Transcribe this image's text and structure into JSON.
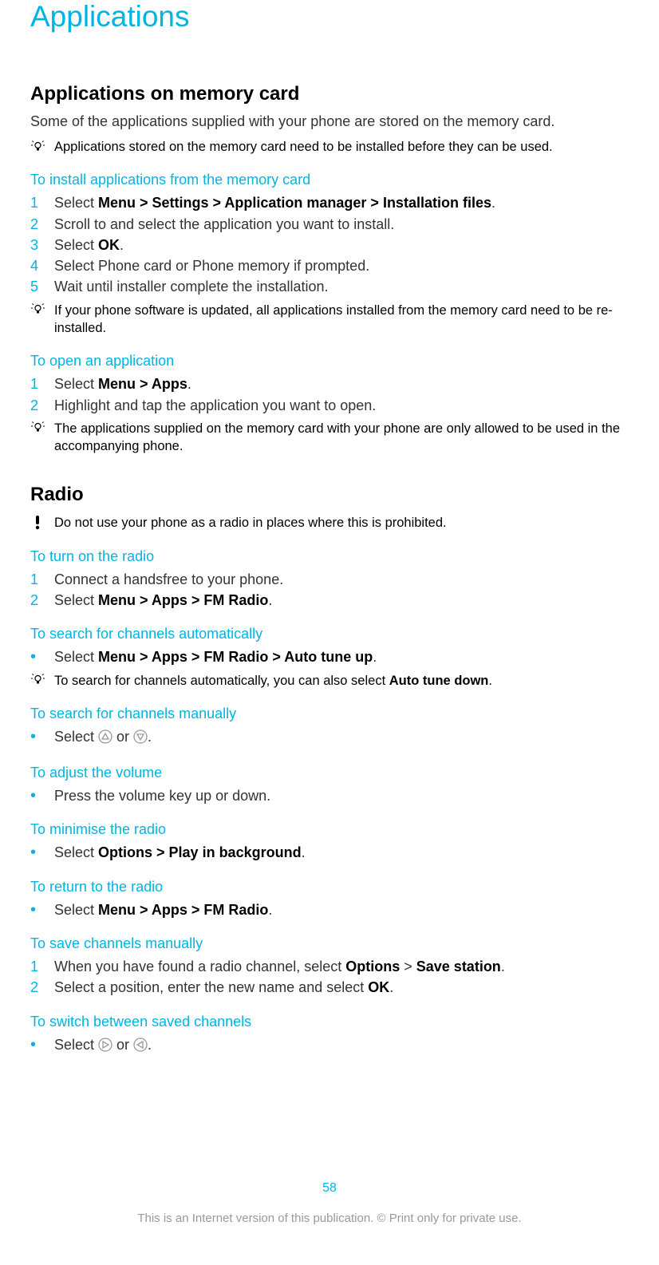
{
  "chapterTitle": "Applications",
  "section1": {
    "title": "Applications on memory card",
    "intro": "Some of the applications supplied with your phone are stored on the memory card.",
    "tip1": "Applications stored on the memory card need to be installed before they can be used.",
    "sub1": {
      "title": "To install applications from the memory card",
      "steps": [
        {
          "n": "1",
          "prefix": "Select ",
          "path": "Menu > Settings > Application manager > Installation files",
          "suffix": "."
        },
        {
          "n": "2",
          "plain": "Scroll to and select the application you want to install."
        },
        {
          "n": "3",
          "prefix": "Select ",
          "bold": "OK",
          "suffix": "."
        },
        {
          "n": "4",
          "plain": "Select Phone card or Phone memory if prompted."
        },
        {
          "n": "5",
          "plain": "Wait until installer complete the installation."
        }
      ],
      "tip": "If your phone software is updated, all applications installed from the memory card need to be re-installed."
    },
    "sub2": {
      "title": "To open an application",
      "steps": [
        {
          "n": "1",
          "prefix": "Select ",
          "path": "Menu > Apps",
          "suffix": "."
        },
        {
          "n": "2",
          "plain": "Highlight and tap the application you want to open."
        }
      ],
      "tip": "The applications supplied on the memory card with your phone are only allowed to be used in the accompanying phone."
    }
  },
  "section2": {
    "title": "Radio",
    "warning": "Do not use your phone as a radio in places where this is prohibited.",
    "sub1": {
      "title": "To turn on the radio",
      "steps": [
        {
          "n": "1",
          "plain": "Connect a handsfree to your phone."
        },
        {
          "n": "2",
          "prefix": "Select ",
          "path": "Menu > Apps > FM Radio",
          "suffix": "."
        }
      ]
    },
    "sub2": {
      "title": "To search for channels automatically",
      "bullet": {
        "prefix": "Select ",
        "path": "Menu > Apps > FM Radio > Auto tune up",
        "suffix": "."
      },
      "tipPrefix": "To search for channels automatically, you can also select ",
      "tipBold": "Auto tune down",
      "tipSuffix": "."
    },
    "sub3": {
      "title": "To search for channels manually",
      "bulletPrefix": "Select ",
      "bulletMid": " or ",
      "bulletSuffix": "."
    },
    "sub4": {
      "title": "To adjust the volume",
      "bullet": "Press the volume key up or down."
    },
    "sub5": {
      "title": "To minimise the radio",
      "bullet": {
        "prefix": "Select ",
        "path": "Options > Play in background",
        "suffix": "."
      }
    },
    "sub6": {
      "title": "To return to the radio",
      "bullet": {
        "prefix": "Select ",
        "path": "Menu > Apps > FM Radio",
        "suffix": "."
      }
    },
    "sub7": {
      "title": "To save channels manually",
      "steps": [
        {
          "n": "1"
        },
        {
          "n": "2"
        }
      ],
      "s1_a": "When you have found a radio channel, select ",
      "s1_b": "Options",
      "s1_c": " > ",
      "s1_d": "Save station",
      "s1_e": ".",
      "s2_a": "Select a position, enter the new name and select ",
      "s2_b": "OK",
      "s2_c": "."
    },
    "sub8": {
      "title": "To switch between saved channels",
      "bulletPrefix": "Select ",
      "bulletMid": " or ",
      "bulletSuffix": "."
    }
  },
  "pageNumber": "58",
  "disclaimer": "This is an Internet version of this publication. © Print only for private use."
}
